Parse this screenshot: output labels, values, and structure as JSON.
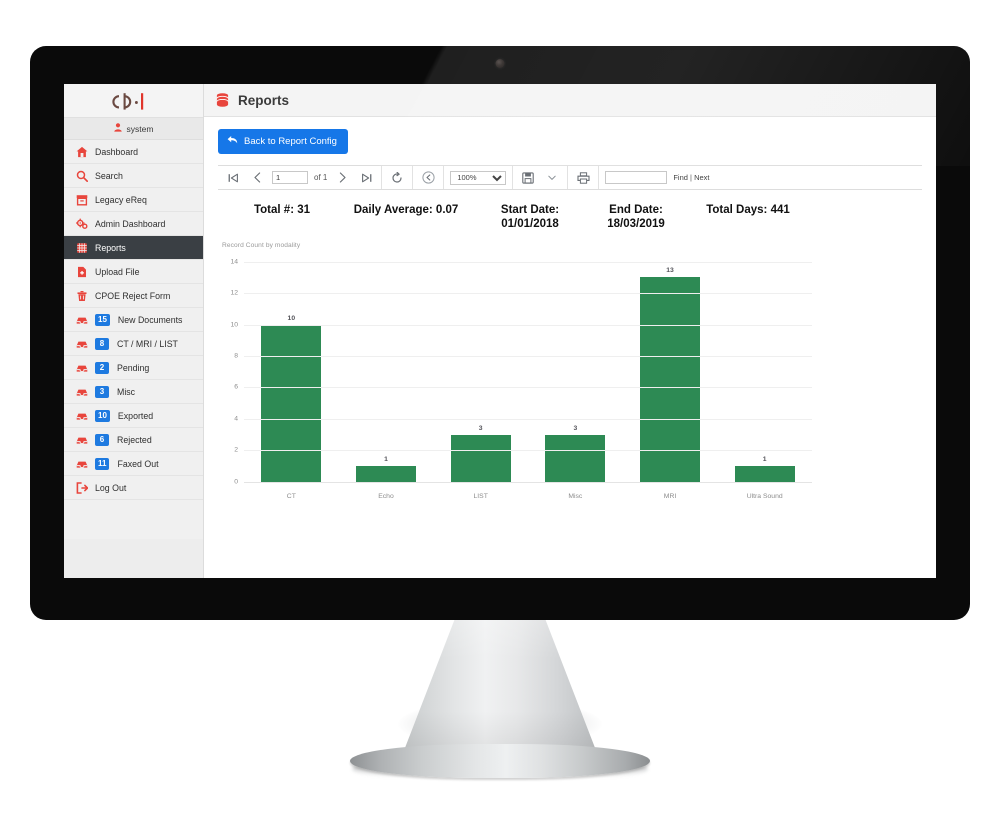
{
  "brand": {
    "logo_text": "cp·l"
  },
  "sidebar": {
    "user": {
      "label": "system",
      "icon": "user-icon"
    },
    "items": [
      {
        "label": "Dashboard",
        "icon": "home-icon",
        "badge": null,
        "active": false
      },
      {
        "label": "Search",
        "icon": "search-icon",
        "badge": null,
        "active": false
      },
      {
        "label": "Legacy eReq",
        "icon": "archive-icon",
        "badge": null,
        "active": false
      },
      {
        "label": "Admin Dashboard",
        "icon": "gears-icon",
        "badge": null,
        "active": false
      },
      {
        "label": "Reports",
        "icon": "grid-report-icon",
        "badge": null,
        "active": true
      },
      {
        "label": "Upload File",
        "icon": "file-upload-icon",
        "badge": null,
        "active": false
      },
      {
        "label": "CPOE Reject Form",
        "icon": "trash-form-icon",
        "badge": null,
        "active": false
      },
      {
        "label": "New Documents",
        "icon": "inbox-icon",
        "badge": "15",
        "active": false
      },
      {
        "label": "CT / MRI / LIST",
        "icon": "inbox-icon",
        "badge": "8",
        "active": false
      },
      {
        "label": "Pending",
        "icon": "inbox-icon",
        "badge": "2",
        "active": false
      },
      {
        "label": "Misc",
        "icon": "inbox-icon",
        "badge": "3",
        "active": false
      },
      {
        "label": "Exported",
        "icon": "inbox-icon",
        "badge": "10",
        "active": false
      },
      {
        "label": "Rejected",
        "icon": "inbox-icon",
        "badge": "6",
        "active": false
      },
      {
        "label": "Faxed Out",
        "icon": "inbox-icon",
        "badge": "11",
        "active": false
      },
      {
        "label": "Log Out",
        "icon": "logout-icon",
        "badge": null,
        "active": false
      }
    ]
  },
  "topbar": {
    "title": "Reports",
    "icon": "database-icon"
  },
  "actions": {
    "back_button_label": "Back to Report Config",
    "back_button_icon": "undo-arrow-icon"
  },
  "report_toolbar": {
    "first_page_icon": "first-page-icon",
    "prev_page_icon": "prev-page-icon",
    "page_value": "1",
    "page_of": "of 1",
    "next_page_icon": "next-page-icon",
    "last_page_icon": "last-page-icon",
    "refresh_icon": "refresh-icon",
    "back_icon": "back-circle-icon",
    "zoom_value": "100%",
    "export_icon": "save-disk-icon",
    "export_caret_icon": "chevron-down-icon",
    "print_icon": "printer-icon",
    "find_value": "",
    "find_label": "Find",
    "find_separator": "|",
    "find_next_label": "Next"
  },
  "summary": [
    {
      "label": "Total #: 31"
    },
    {
      "label": "Daily Average: 0.07"
    },
    {
      "label": "Start Date:",
      "label2": "01/01/2018"
    },
    {
      "label": "End Date:",
      "label2": "18/03/2019"
    },
    {
      "label": "Total Days: 441"
    }
  ],
  "chart_data": {
    "type": "bar",
    "title": "Record Count by modality",
    "xlabel": "",
    "ylabel": "",
    "categories": [
      "CT",
      "Echo",
      "LIST",
      "Misc",
      "MRI",
      "Ultra Sound"
    ],
    "values": [
      10,
      1,
      3,
      3,
      13,
      1
    ],
    "data_labels": [
      "10",
      "1",
      "3",
      "3",
      "13",
      "1"
    ],
    "yticks": [
      0,
      2,
      4,
      6,
      8,
      10,
      12,
      14
    ],
    "ytick_labels": [
      "0",
      "2",
      "4",
      "6",
      "8",
      "10",
      "12",
      "14"
    ],
    "ylim": [
      0,
      14
    ],
    "grid": true,
    "legend": false,
    "bar_color": "#2d8a54"
  },
  "colors": {
    "accent_red": "#e8453c",
    "accent_blue": "#1677e8",
    "badge_blue": "#1e7ae0",
    "bar_green": "#2d8a54",
    "sidebar_bg": "#f0f0f0",
    "active_nav_bg": "#3a3f44"
  }
}
